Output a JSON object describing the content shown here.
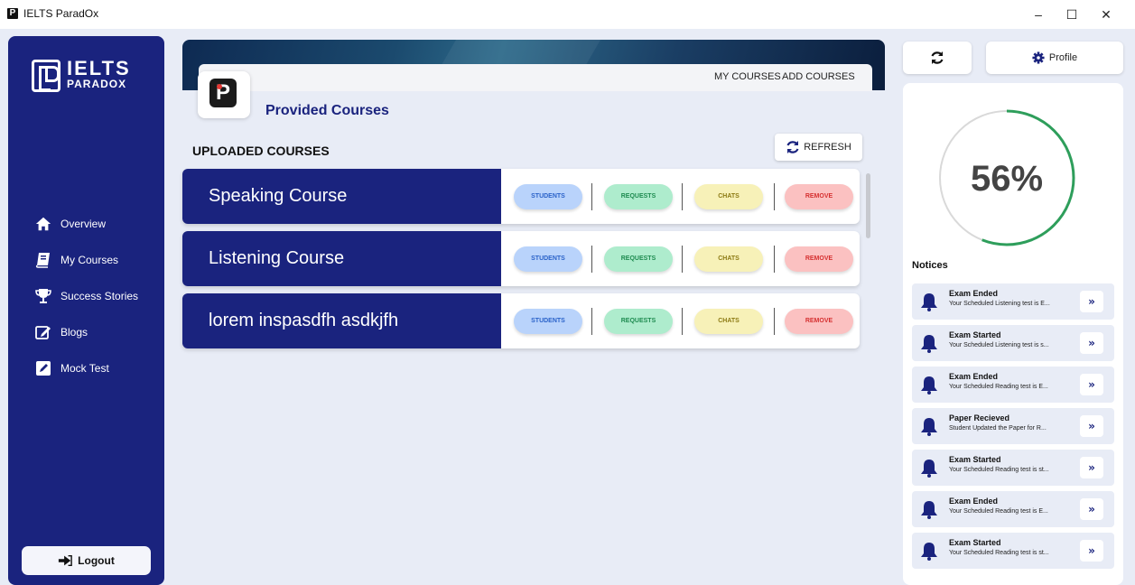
{
  "window": {
    "title": "IELTS ParadOx",
    "minimize": "–",
    "maximize": "☐",
    "close": "✕"
  },
  "sidebar": {
    "logo": {
      "line1": "IELTS",
      "line2": "PARADOX"
    },
    "items": [
      {
        "label": "Overview",
        "icon": "home-icon"
      },
      {
        "label": "My Courses",
        "icon": "book-icon"
      },
      {
        "label": "Success Stories",
        "icon": "trophy-icon"
      },
      {
        "label": "Blogs",
        "icon": "edit-icon"
      },
      {
        "label": "Mock Test",
        "icon": "pencil-icon"
      }
    ],
    "logout": "Logout"
  },
  "header": {
    "tabs": [
      "MY COURSES",
      "ADD COURSES"
    ],
    "page_logo": "P",
    "title": "Provided Courses"
  },
  "section": {
    "title": "UPLOADED COURSES",
    "refresh": "REFRESH"
  },
  "courses": [
    {
      "name": "Speaking Course"
    },
    {
      "name": "Listening Course"
    },
    {
      "name": "lorem inspasdfh asdkjfh"
    }
  ],
  "course_actions": {
    "students": "STUDENTS",
    "requests": "REQUESTS",
    "chats": "CHATS",
    "remove": "REMOVE"
  },
  "right": {
    "profile": "Profile",
    "progress": {
      "value": 56,
      "label": "56%"
    },
    "notices_title": "Notices",
    "notices": [
      {
        "title": "Exam Ended",
        "text": "Your Scheduled Listening test is E..."
      },
      {
        "title": "Exam Started",
        "text": "Your Scheduled Listening test is s..."
      },
      {
        "title": "Exam Ended",
        "text": "Your Scheduled Reading test is E..."
      },
      {
        "title": "Paper Recieved",
        "text": "Student Updated the Paper for R..."
      },
      {
        "title": "Exam Started",
        "text": "Your Scheduled Reading test is st..."
      },
      {
        "title": "Exam Ended",
        "text": "Your Scheduled Reading test is E..."
      },
      {
        "title": "Exam Started",
        "text": "Your Scheduled Reading test is st..."
      }
    ],
    "notice_button": "»"
  },
  "colors": {
    "primary": "#1a237e",
    "background": "#e8ecf6",
    "progress": "#2e9e5b",
    "students": "#b9d3fb",
    "requests": "#aeeccd",
    "chats": "#f7f1b8",
    "remove": "#fbc1c1"
  }
}
